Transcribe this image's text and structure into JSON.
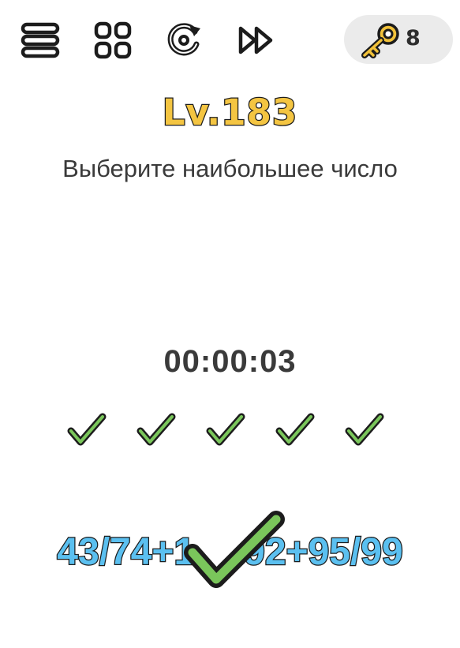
{
  "toolbar": {
    "menu_icon": "menu-icon",
    "levels_icon": "levels-grid-icon",
    "restart_icon": "restart-icon",
    "skip_icon": "skip-icon"
  },
  "hints": {
    "icon": "key-icon",
    "count": "8"
  },
  "level": {
    "label": "Lv.183"
  },
  "question": {
    "text": "Выберите наибольшее число"
  },
  "timer": {
    "value": "00:00:03"
  },
  "progress": {
    "checks_completed": 5,
    "icon": "check-icon"
  },
  "answer": {
    "expression_left": "43/74+1",
    "expression_right": "92+95/99",
    "result_icon": "check-icon"
  },
  "colors": {
    "level_fill": "#f4c542",
    "expression_fill": "#5bc0f0",
    "check_green": "#7ac65b",
    "outline": "#1c1c1c",
    "pill_bg": "#ebebeb",
    "key_gold": "#f2c23a"
  }
}
